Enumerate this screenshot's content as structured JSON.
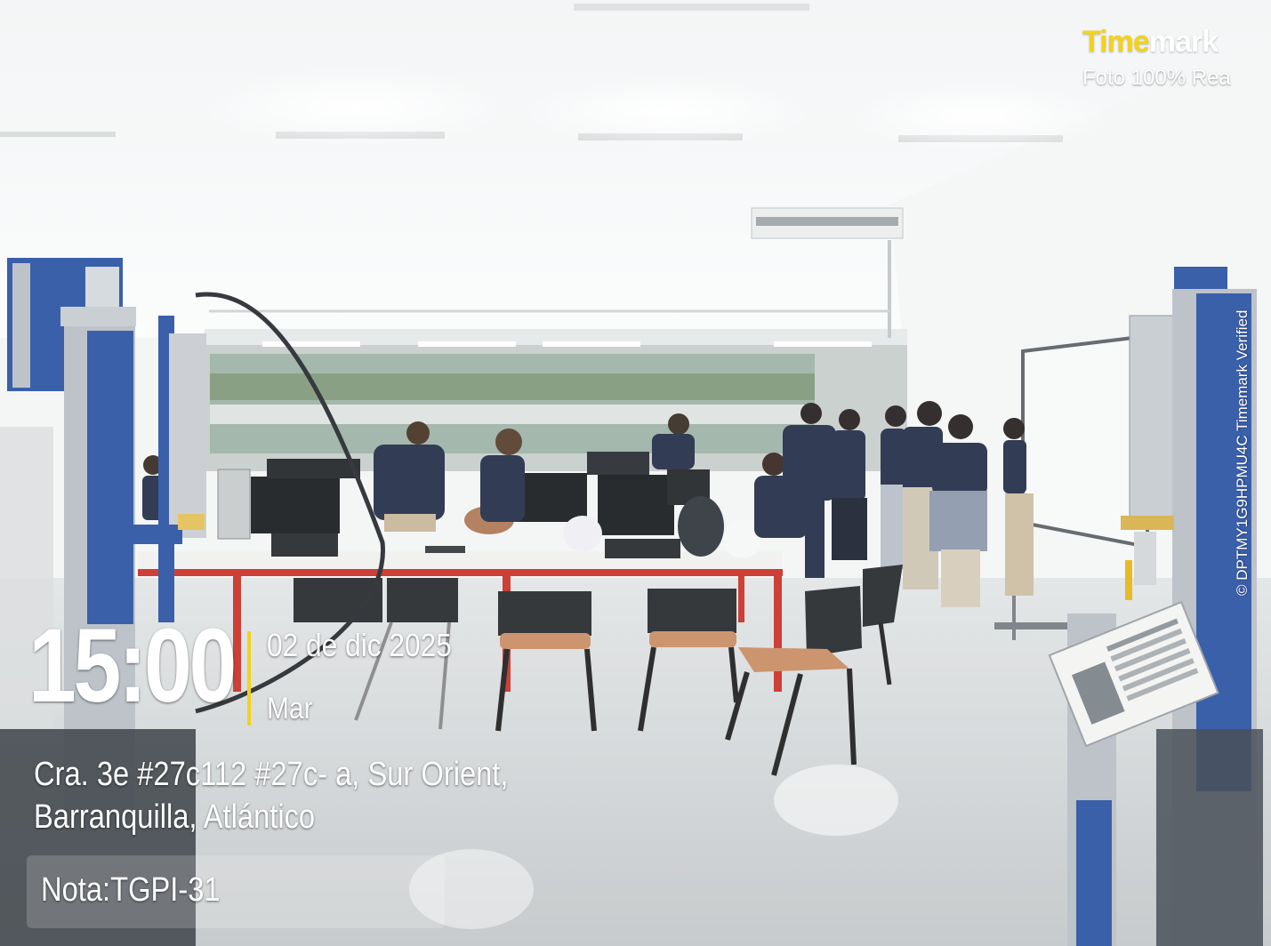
{
  "photo": {
    "description_alt": "",
    "palette": {
      "ceiling": "#f7f9f9",
      "floor": "#d7dadb",
      "table_top": "#f1f2f0",
      "table_frame": "#c9352b",
      "chair": "#2a2d30",
      "chair_seat": "#c98f66",
      "uniform": "#26304a",
      "machine_blue": "#2f57a5",
      "aluminium": "#b9c0c6",
      "accent_yellow": "#f2d21c"
    }
  },
  "overlay": {
    "time": "15:00",
    "date": "02 de dic 2025",
    "weekday": "Mar",
    "address_line1": "Cra. 3e #27c112 #27c- a, Sur Orient,",
    "address_line2": "Barranquilla, Atlántico",
    "note": "Nota:TGPI-31"
  },
  "watermark": {
    "brand_part1": "Time",
    "brand_part2": "mark",
    "subtitle": "Foto 100% Rea",
    "verification": "© DPTMY1G9HPMU4C  Timemark Verified"
  }
}
